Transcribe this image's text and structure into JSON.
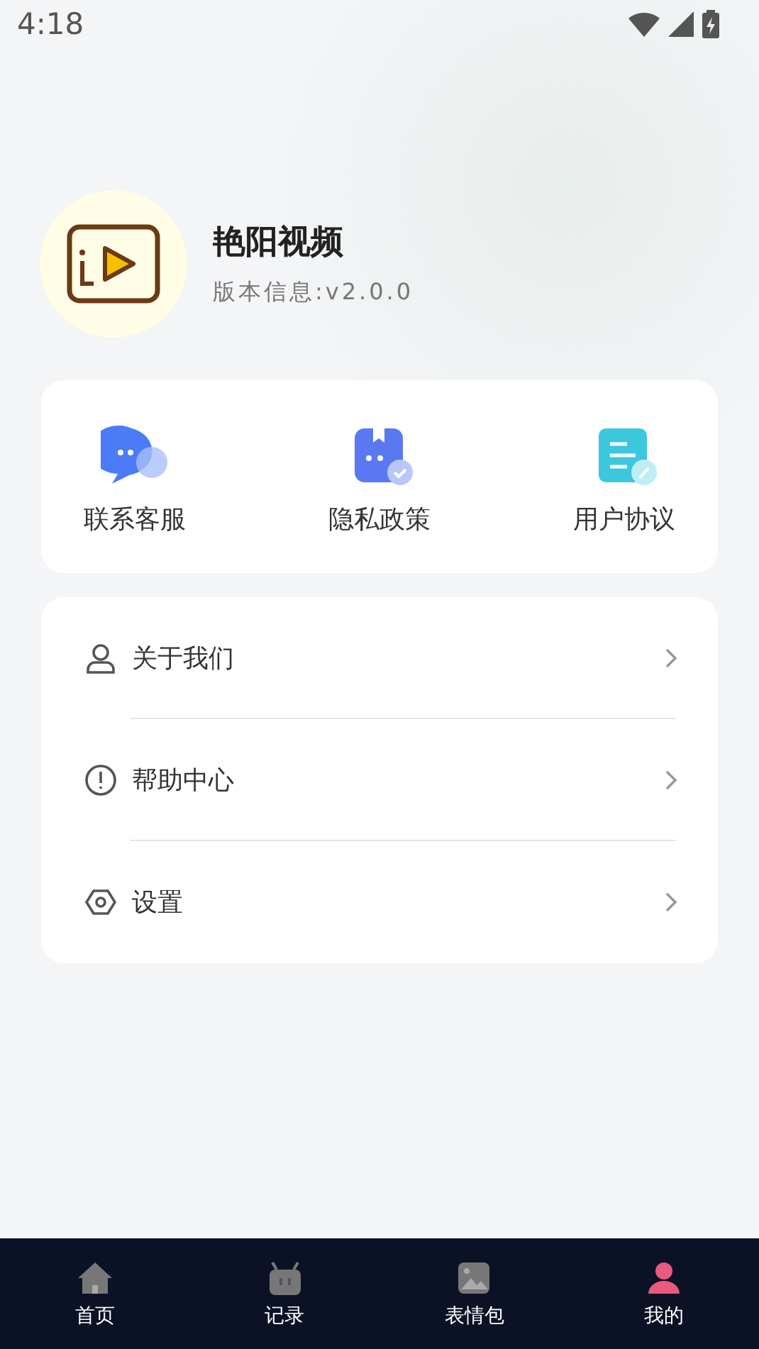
{
  "status_bar": {
    "time": "4:18"
  },
  "profile": {
    "name": "艳阳视频",
    "version": "版本信息:v2.0.0"
  },
  "shortcuts": [
    {
      "kind": "chat",
      "label": "联系客服"
    },
    {
      "kind": "privacy",
      "label": "隐私政策"
    },
    {
      "kind": "agreement",
      "label": "用户协议"
    }
  ],
  "menu": [
    {
      "kind": "user",
      "label": "关于我们"
    },
    {
      "kind": "help",
      "label": "帮助中心"
    },
    {
      "kind": "settings",
      "label": "设置"
    }
  ],
  "tabs": [
    {
      "kind": "home",
      "label": "首页",
      "selected": false
    },
    {
      "kind": "record",
      "label": "记录",
      "selected": false
    },
    {
      "kind": "sticker",
      "label": "表情包",
      "selected": false
    },
    {
      "kind": "me",
      "label": "我的",
      "selected": true
    }
  ]
}
